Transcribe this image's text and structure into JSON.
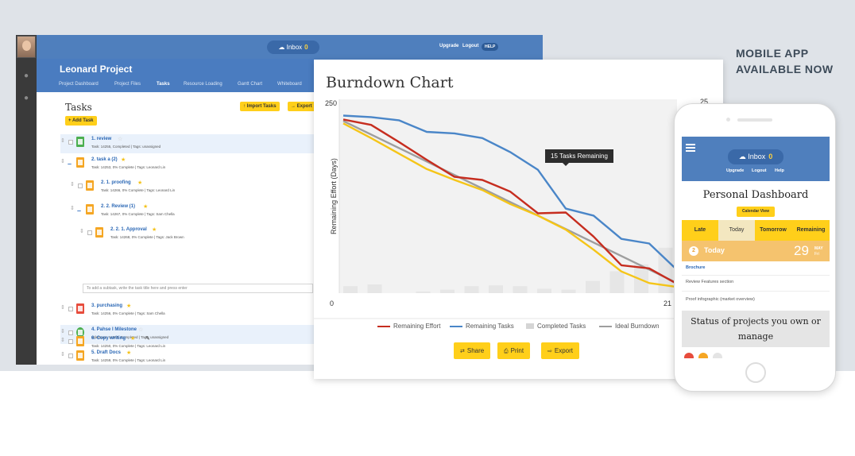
{
  "promo": {
    "line1": "MOBILE APP",
    "line2": "AVAILABLE NOW"
  },
  "desktop": {
    "inbox_label": "Inbox",
    "inbox_count": "0",
    "top_links": [
      "Upgrade",
      "Logout"
    ],
    "help_label": "HELP",
    "project_title": "Leonard Project",
    "tabs": [
      "Project Dashboard",
      "Project Files",
      "Tasks",
      "Resource Loading",
      "Gantt Chart",
      "Whiteboard"
    ],
    "active_tab": "Tasks",
    "tasks_title": "Tasks",
    "add_task_label": "Add Task",
    "import_label": "Import Tasks",
    "export_label": "Export",
    "subtask_placeholder": "To add a subtask, write the task title here and press enter",
    "tasks": [
      {
        "name": "1.  review",
        "meta": "Task: 14255, Completed   |   Tags: unassigned",
        "color": "#4caf50",
        "starred": false
      },
      {
        "name": "2.  task a (2)",
        "meta": "Task: 14253, 0% Complete   |   Tags: Leonard Lin",
        "color": "#f5a623",
        "starred": true
      },
      {
        "name": "2. 1.  proofing",
        "meta": "Task: 14266, 0% Complete   |   Tags: Leonard Lin",
        "color": "#f5a623",
        "starred": true
      },
      {
        "name": "2. 2.  Review (1)",
        "meta": "Task: 14267, 0% Complete   |   Tags: Sam Chella",
        "color": "#f5a623",
        "starred": true
      },
      {
        "name": "2. 2. 1.  Approval",
        "meta": "Task: 14268, 0% Complete   |   Tags: Jack Brown",
        "color": "#f5a623",
        "starred": true
      },
      {
        "name": "3.  purchasing",
        "meta": "Task: 14256, 0% Complete   |   Tags: Sam Chella",
        "color": "#e74c3c",
        "starred": true
      },
      {
        "name": "4.  Pahse I Milestone",
        "meta": "Milestone: 14265, Completed   |   Tags: unassigned",
        "color": "#4caf50",
        "starred": false
      },
      {
        "name": "5.  Draft Docs",
        "meta": "Task: 14259, 0% Complete   |   Tags: Leonard Lin",
        "color": "#f5a623",
        "starred": true
      },
      {
        "name": "6.  Copy writing",
        "meta": "Task: 14250, 0% Complete   |   Tags: Leonard Lin",
        "color": "#f5a623",
        "starred": true
      }
    ]
  },
  "burndown": {
    "title": "Burndown Chart",
    "tooltip": "15 Tasks Remaining",
    "buttons": [
      "Share",
      "Print",
      "Export"
    ]
  },
  "chart_data": {
    "type": "line",
    "title": "Burndown Chart",
    "ylabel": "Remaining Effort (Days)",
    "xlabel": "",
    "ylim": [
      0,
      250
    ],
    "xlim": [
      0,
      21
    ],
    "y_tick_labels": [
      "250",
      "0"
    ],
    "x_tick_labels": [
      "0",
      "21"
    ],
    "right_axis_top_label": "25",
    "grid": false,
    "legend_position": "bottom",
    "colors": {
      "effort": "#c62d1f",
      "tasks": "#4a86c8",
      "completed": "#e6e6e6",
      "ideal": "#9e9e9e",
      "yellow": "#f5c518"
    },
    "series": [
      {
        "name": "Remaining Effort",
        "kind": "line",
        "color": "#c62d1f",
        "points": [
          [
            0,
            224
          ],
          [
            1,
            217
          ],
          [
            2,
            195
          ],
          [
            3,
            172
          ],
          [
            4,
            150
          ],
          [
            5,
            146
          ],
          [
            6,
            131
          ],
          [
            7,
            103
          ],
          [
            8,
            104
          ],
          [
            9,
            73
          ],
          [
            10,
            36
          ],
          [
            11,
            32
          ],
          [
            12,
            12
          ]
        ]
      },
      {
        "name": "Remaining Tasks",
        "kind": "line",
        "color": "#4a86c8",
        "points": [
          [
            0,
            229
          ],
          [
            1,
            227
          ],
          [
            2,
            223
          ],
          [
            3,
            208
          ],
          [
            4,
            206
          ],
          [
            5,
            200
          ],
          [
            6,
            182
          ],
          [
            7,
            159
          ],
          [
            8,
            109
          ],
          [
            9,
            100
          ],
          [
            10,
            70
          ],
          [
            11,
            64
          ],
          [
            12,
            30
          ]
        ]
      },
      {
        "name": "",
        "kind": "line",
        "color": "#f5c518",
        "points": [
          [
            0,
            219
          ],
          [
            1,
            200
          ],
          [
            2,
            180
          ],
          [
            3,
            160
          ],
          [
            4,
            146
          ],
          [
            5,
            133
          ],
          [
            6,
            115
          ],
          [
            7,
            100
          ],
          [
            8,
            82
          ],
          [
            9,
            56
          ],
          [
            10,
            28
          ],
          [
            11,
            13
          ],
          [
            12,
            8
          ]
        ]
      },
      {
        "name": "Ideal Burndown",
        "kind": "line",
        "color": "#9e9e9e",
        "points": [
          [
            0,
            222
          ],
          [
            12,
            13
          ]
        ]
      },
      {
        "name": "Completed Tasks",
        "kind": "bar",
        "color": "#e6e6e6",
        "x": [
          0,
          1,
          2,
          3,
          4,
          5,
          6,
          7,
          8,
          9,
          10,
          11,
          12,
          13
        ],
        "values": [
          0.8,
          1,
          0,
          0.2,
          0.4,
          0.8,
          0.9,
          0.8,
          0.5,
          0.4,
          1.4,
          2.5,
          3.3,
          5.2
        ]
      }
    ],
    "tooltip_text": "15 Tasks Remaining"
  },
  "mobile": {
    "inbox_label": "Inbox",
    "inbox_count": "0",
    "links": [
      "Upgrade",
      "Logout",
      "Help"
    ],
    "title": "Personal Dashboard",
    "calendar_label": "Calendar View",
    "tabs": [
      "Late",
      "Today",
      "Tomorrow",
      "Remaining"
    ],
    "today_count": "2",
    "today_label": "Today",
    "date_num": "29",
    "date_month": "MAY",
    "date_day": "Fri",
    "items": [
      "Brochure",
      "Review Features section",
      "Proof infographic (market overview)"
    ],
    "status_text": "Status of projects you own or manage"
  }
}
